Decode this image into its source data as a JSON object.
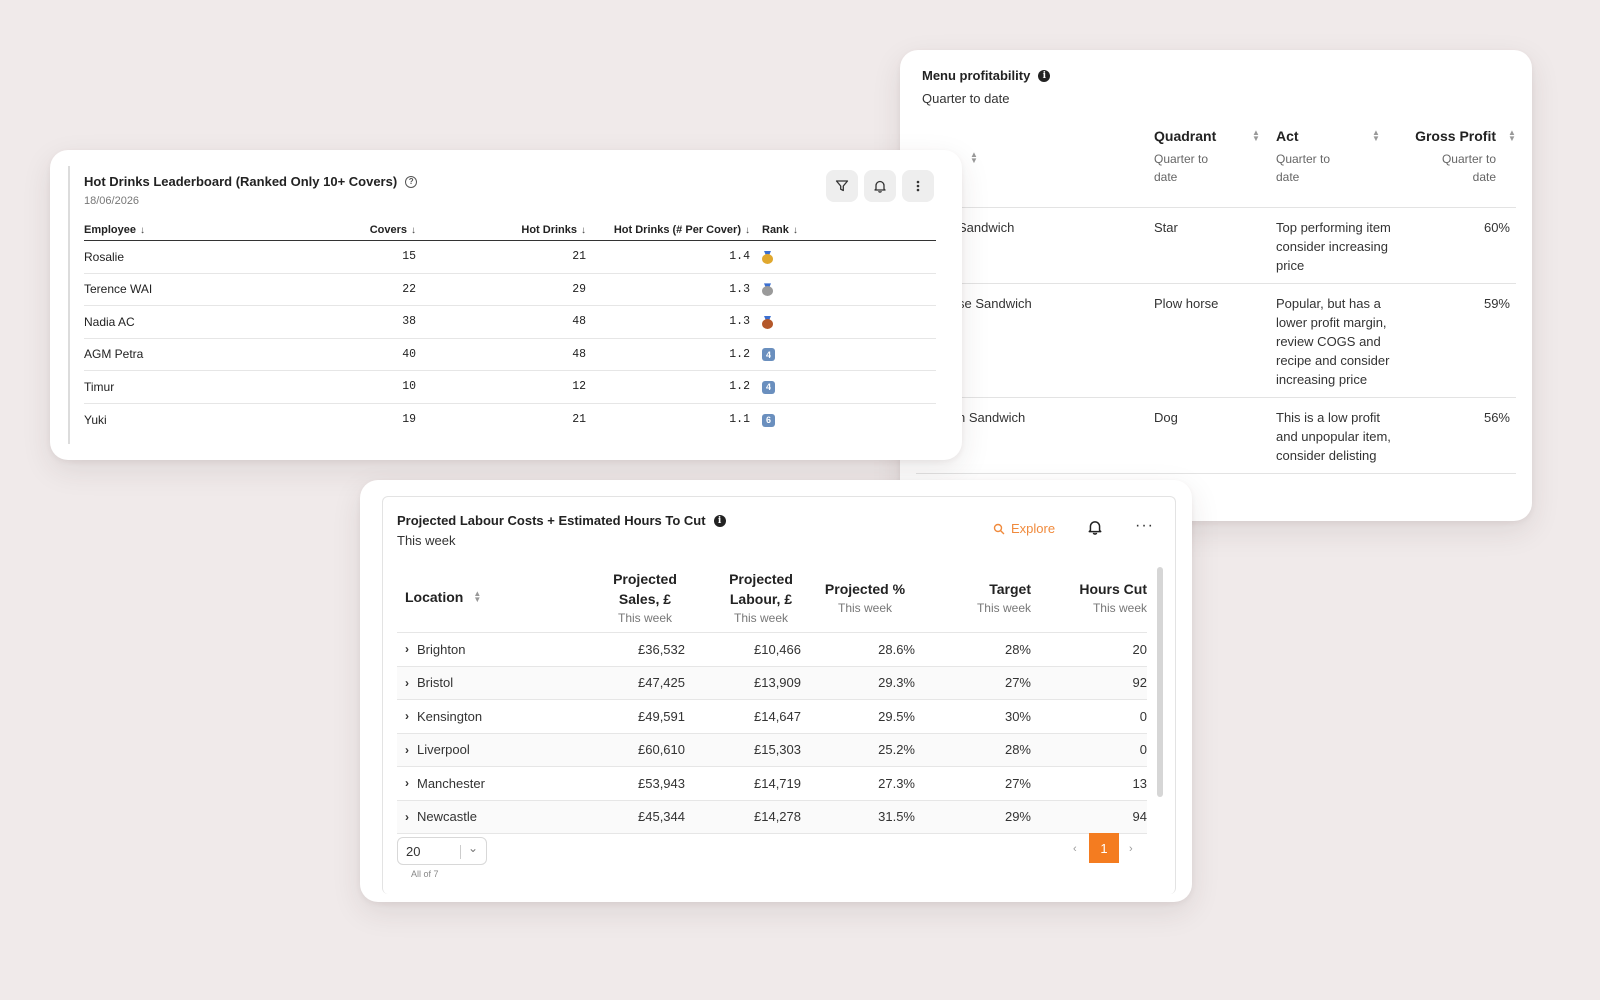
{
  "menu": {
    "title": "Menu profitability",
    "subtitle": "Quarter to date",
    "columns": [
      {
        "name": "",
        "sub": ""
      },
      {
        "name": "Quadrant",
        "sub": "Quarter to date"
      },
      {
        "name": "Act",
        "sub": "Quarter to date"
      },
      {
        "name": "Gross Profit",
        "sub": "Quarter to date"
      }
    ],
    "rows": [
      {
        "item": "Sandwich",
        "quadrant": "Star",
        "act": "Top performing item consider increasing price",
        "gp": "60%"
      },
      {
        "item": "se Sandwich",
        "quadrant": "Plow horse",
        "act": "Popular, but has a lower profit margin, review COGS and recipe and consider increasing price",
        "gp": "59%"
      },
      {
        "item": "n Sandwich",
        "quadrant": "Dog",
        "act": "This is a low profit and unpopular item, consider delisting",
        "gp": "56%"
      }
    ]
  },
  "hot": {
    "title": "Hot Drinks Leaderboard (Ranked Only 10+ Covers)",
    "date": "18/06/2026",
    "columns": [
      "Employee",
      "Covers",
      "Hot Drinks",
      "Hot Drinks (# Per Cover)",
      "Rank"
    ],
    "rows": [
      {
        "employee": "Rosalie",
        "covers": "15",
        "hot": "21",
        "per": "1.4",
        "rank": "gold"
      },
      {
        "employee": "Terence WAI",
        "covers": "22",
        "hot": "29",
        "per": "1.3",
        "rank": "silver"
      },
      {
        "employee": "Nadia AC",
        "covers": "38",
        "hot": "48",
        "per": "1.3",
        "rank": "bronze"
      },
      {
        "employee": "AGM Petra",
        "covers": "40",
        "hot": "48",
        "per": "1.2",
        "rank": "4"
      },
      {
        "employee": "Timur",
        "covers": "10",
        "hot": "12",
        "per": "1.2",
        "rank": "4"
      },
      {
        "employee": "Yuki",
        "covers": "19",
        "hot": "21",
        "per": "1.1",
        "rank": "6"
      }
    ],
    "colors": {
      "gold": "#e0a82e",
      "silver": "#9a9a9a",
      "bronze": "#b4582a"
    }
  },
  "labour": {
    "title": "Projected Labour Costs + Estimated Hours To Cut",
    "subtitle": "This week",
    "explore": "Explore",
    "columns": [
      {
        "name": "Location",
        "sub": ""
      },
      {
        "name": "Projected Sales, £",
        "sub": "This week"
      },
      {
        "name": "Projected Labour, £",
        "sub": "This week"
      },
      {
        "name": "Projected %",
        "sub": "This week"
      },
      {
        "name": "Target",
        "sub": "This week"
      },
      {
        "name": "Hours Cut",
        "sub": "This week"
      }
    ],
    "rows": [
      {
        "loc": "Brighton",
        "sales": "£36,532",
        "labour": "£10,466",
        "pct": "28.6%",
        "target": "28%",
        "cut": "20"
      },
      {
        "loc": "Bristol",
        "sales": "£47,425",
        "labour": "£13,909",
        "pct": "29.3%",
        "target": "27%",
        "cut": "92"
      },
      {
        "loc": "Kensington",
        "sales": "£49,591",
        "labour": "£14,647",
        "pct": "29.5%",
        "target": "30%",
        "cut": "0"
      },
      {
        "loc": "Liverpool",
        "sales": "£60,610",
        "labour": "£15,303",
        "pct": "25.2%",
        "target": "28%",
        "cut": "0"
      },
      {
        "loc": "Manchester",
        "sales": "£53,943",
        "labour": "£14,719",
        "pct": "27.3%",
        "target": "27%",
        "cut": "13"
      },
      {
        "loc": "Newcastle",
        "sales": "£45,344",
        "labour": "£14,278",
        "pct": "31.5%",
        "target": "29%",
        "cut": "94"
      }
    ],
    "page_size": "20",
    "all_of": "All of 7",
    "page": "1",
    "accent": "#f47c20"
  }
}
